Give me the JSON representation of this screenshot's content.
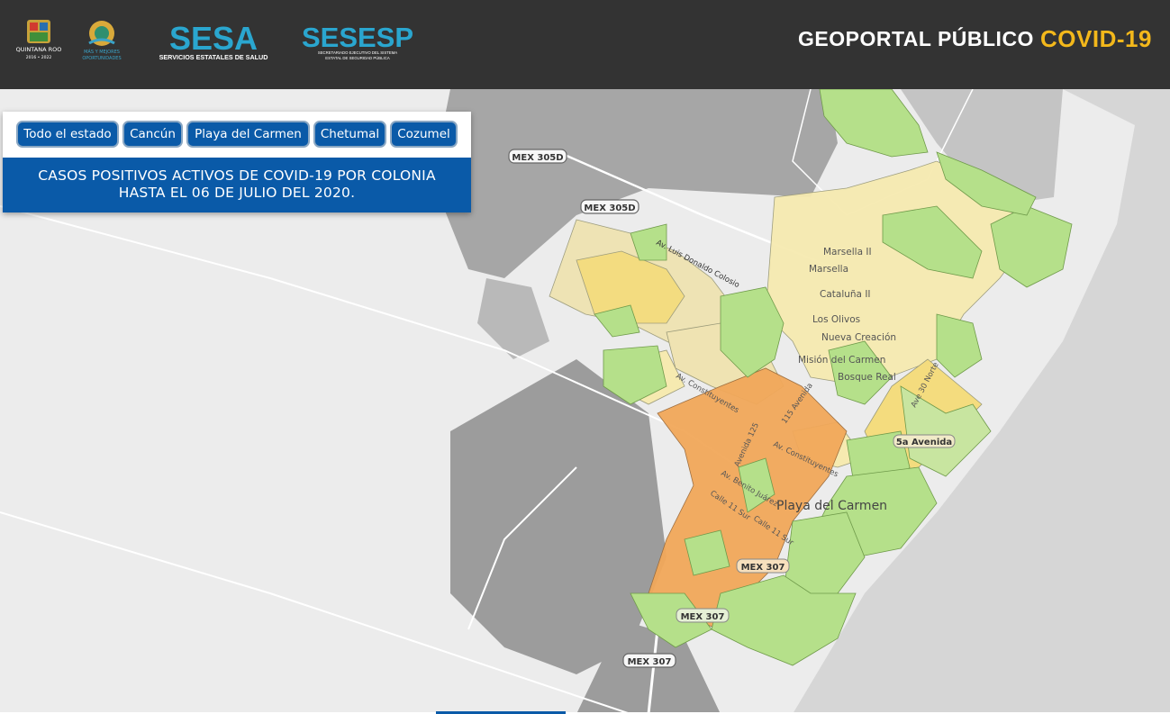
{
  "header": {
    "portal_title": "GEOPORTAL PÚBLICO",
    "portal_subtitle": "COVID-19",
    "logos": {
      "gob": {
        "name": "QUINTANA ROO",
        "years": "2016 • 2022"
      },
      "mas": {
        "line1": "MÁS Y MEJORES",
        "line2": "OPORTUNIDADES"
      },
      "sesa": {
        "title": "SESA",
        "subtitle": "SERVICIOS ESTATALES DE SALUD"
      },
      "sesesp": {
        "title": "SESESP",
        "line1": "SECRETARIADO EJECUTIVO DEL SISTEMA",
        "line2": "ESTATAL DE SEGURIDAD PÚBLICA"
      }
    }
  },
  "panel": {
    "buttons": [
      "Todo el estado",
      "Cancún",
      "Playa del Carmen",
      "Chetumal",
      "Cozumel"
    ],
    "title_line1": "CASOS POSITIVOS ACTIVOS DE COVID-19 POR COLONIA",
    "title_line2": "HASTA EL 06 DE JULIO DEL 2020."
  },
  "map": {
    "road_shields": [
      "MEX 305D",
      "MEX 305D",
      "MEX 307",
      "MEX 307",
      "MEX 307"
    ],
    "street_labels": [
      "Av. Luis Donaldo Colosio",
      "Av. Constituyentes",
      "115 Avenida",
      "Avenida 125",
      "Av. Constituyentes",
      "Av. Benito Juárez",
      "Calle 11 Sur",
      "Calle 11 Sur",
      "Ave 30 Norte",
      "5a Avenida"
    ],
    "place_labels": [
      "Marsella II",
      "Marsella",
      "Cataluña II",
      "Los Olivos",
      "Nueva Creación",
      "Misión del Carmen",
      "Bosque Real"
    ],
    "city_label": "Playa del Carmen",
    "colors": {
      "green": "#b5e08a",
      "pale_yellow": "#f6eab0",
      "yellow": "#f4dc7e",
      "orange": "#f2a85a",
      "sea": "#d7d7d7",
      "land": "#ededed",
      "built": "#a9a9a9"
    }
  }
}
